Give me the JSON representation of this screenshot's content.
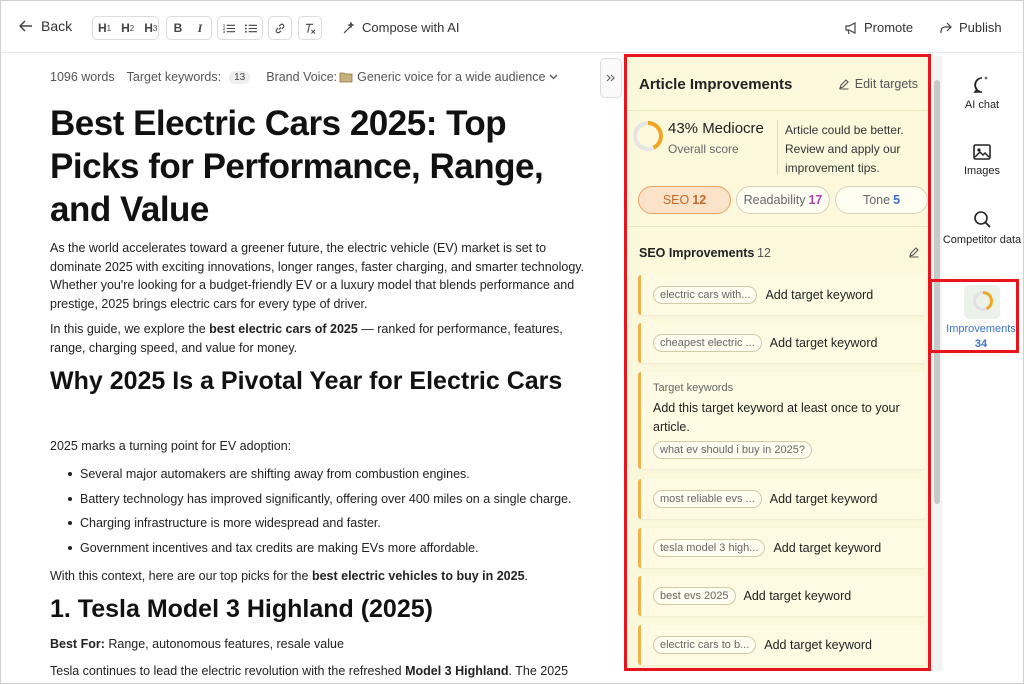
{
  "toolbar": {
    "back_label": "Back",
    "h1": "H",
    "h2": "H",
    "h3": "H",
    "sub1": "1",
    "sub2": "2",
    "sub3": "3",
    "bold": "B",
    "italic": "I",
    "compose_label": "Compose with AI",
    "promote_label": "Promote",
    "publish_label": "Publish"
  },
  "meta": {
    "word_count": "1096 words",
    "target_keywords_label": "Target keywords:",
    "target_keywords_count": "13",
    "brand_voice_label": "Brand Voice:",
    "brand_voice_value": "Generic voice for a wide audience"
  },
  "article": {
    "title": "Best Electric Cars 2025: Top Picks for Performance, Range, and Value",
    "intro": "As the world accelerates toward a greener future, the electric vehicle (EV) market is set to dominate 2025 with exciting innovations, longer ranges, faster charging, and smarter technology. Whether you're looking for a budget-friendly EV or a luxury model that blends performance and prestige, 2025 brings electric cars for every type of driver.",
    "guide_prefix": "In this guide, we explore the ",
    "guide_bold": "best electric cars of 2025",
    "guide_suffix": " — ranked for performance, features, range, charging speed, and value for money.",
    "h2": "Why 2025 Is a Pivotal Year for Electric Cars",
    "turning_point": "2025 marks a turning point for EV adoption:",
    "bullets": [
      "Several major automakers are shifting away from combustion engines.",
      "Battery technology has improved significantly, offering over 400 miles on a single charge.",
      "Charging infrastructure is more widespread and faster.",
      "Government incentives and tax credits are making EVs more affordable."
    ],
    "context_prefix": "With this context, here are our top picks for the ",
    "context_bold": "best electric vehicles to buy in 2025",
    "context_suffix": ".",
    "h3": "1. Tesla Model 3 Highland (2025)",
    "best_for_label": "Best For:",
    "best_for_value": " Range, autonomous features, resale value",
    "tesla_prefix": "Tesla continues to lead the electric revolution with the refreshed ",
    "tesla_bold": "Model 3 Highland",
    "tesla_suffix": ". The 2025"
  },
  "panel": {
    "title": "Article Improvements",
    "edit_targets": "Edit targets",
    "score": "43% Mediocre",
    "score_fraction": 0.43,
    "score_label": "Overall score",
    "score_desc": "Article could be better. Review and apply our improvement tips.",
    "tabs": [
      {
        "label": "SEO",
        "count": "12"
      },
      {
        "label": "Readability",
        "count": "17"
      },
      {
        "label": "Tone",
        "count": "5"
      }
    ],
    "section_title": "SEO Improvements",
    "section_count": "12",
    "cards": [
      {
        "chip": "electric cars with...",
        "action": "Add target keyword"
      },
      {
        "chip": "cheapest electric ...",
        "action": "Add target keyword"
      },
      {
        "chip": "most reliable evs ...",
        "action": "Add target keyword"
      },
      {
        "chip": "tesla model 3 high...",
        "action": "Add target keyword"
      },
      {
        "chip": "best evs 2025",
        "action": "Add target keyword"
      },
      {
        "chip": "electric cars to b...",
        "action": "Add target keyword"
      }
    ],
    "big_card": {
      "small": "Target keywords",
      "msg": "Add this target keyword at least once to your article.",
      "chip": "what ev should i buy in 2025?"
    }
  },
  "rightnav": {
    "ai_chat": "AI chat",
    "images": "Images",
    "competitor_data": "Competitor data",
    "improvements": "Improvements",
    "improvements_count": "34"
  }
}
